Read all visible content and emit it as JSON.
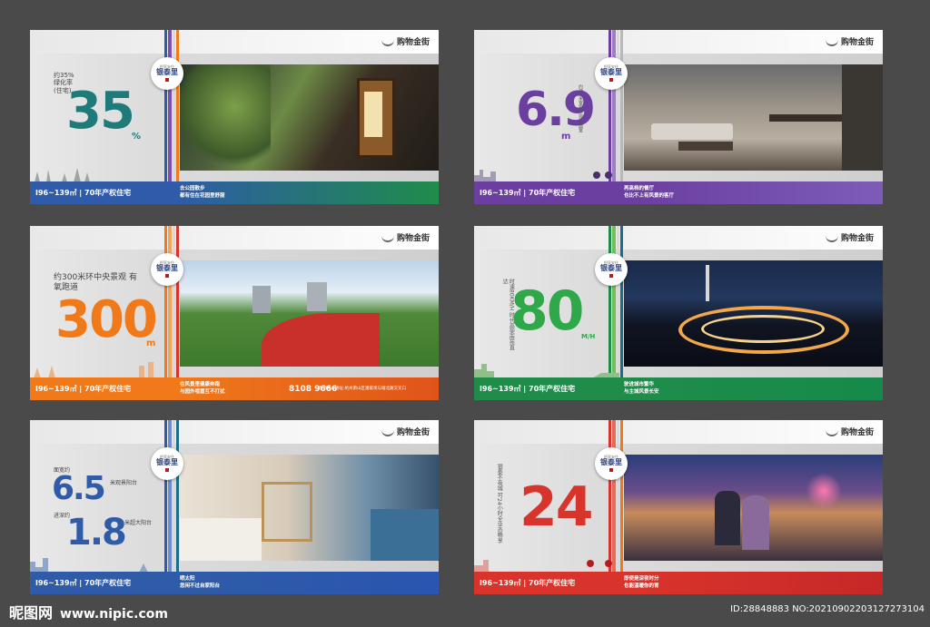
{
  "brand_label": "购物金街",
  "logo": {
    "tag": "把家安住",
    "name": "银泰里"
  },
  "spec": "I96~139㎡ | 70年产权住宅",
  "colors": {
    "blue": "#2f5ba8",
    "green": "#1f8c4a",
    "purple": "#6b3fa0",
    "orange": "#f07a1a",
    "red": "#d9342b",
    "teal": "#1b6d8a"
  },
  "boards": [
    {
      "number": "35",
      "unit": "%",
      "caption": "约35%绿化率(住宅)",
      "tail": [
        "去公园散步",
        "都有住在花园里舒服"
      ]
    },
    {
      "number": "6.9",
      "unit": "m",
      "caption": "约6.9米宽客厅观景面宽",
      "tail": [
        "再高档的餐厅",
        "也比不上有风景的客厅"
      ]
    },
    {
      "number": "300",
      "unit": "m",
      "caption": "约300米环中央景观 有氧跑道",
      "tail": [
        "在风景里健康奔跑",
        "与园外喧嚣互不打扰"
      ],
      "phone": "8108 9666",
      "address": "营销中心地址:杭州萧山区潘家坝与塘北路交叉口"
    },
    {
      "number": "80",
      "unit": "M/H",
      "caption": "时速80KM/H 时代高架南苑直达",
      "tail": [
        "驶进城市繁华",
        "与主城风景长安"
      ]
    },
    {
      "number_a": "6.5",
      "number_b": "1.8",
      "unit": "m",
      "caption_a": "面宽约",
      "caption_b": "进深约",
      "label_a": "米观景阳台",
      "label_b": "米超大阳台",
      "tail": [
        "晒太阳",
        "您闲不过自家阳台"
      ]
    },
    {
      "number": "24",
      "unit": "h",
      "caption": "银泰不夜城 可24小时全业态畅享",
      "tail": [
        "即使是深夜时分",
        "也能温暖你的胃"
      ]
    }
  ],
  "watermark": {
    "site": "昵图网",
    "url": "www.nipic.com",
    "id": "ID:28848883 NO:20210902203127273104"
  }
}
